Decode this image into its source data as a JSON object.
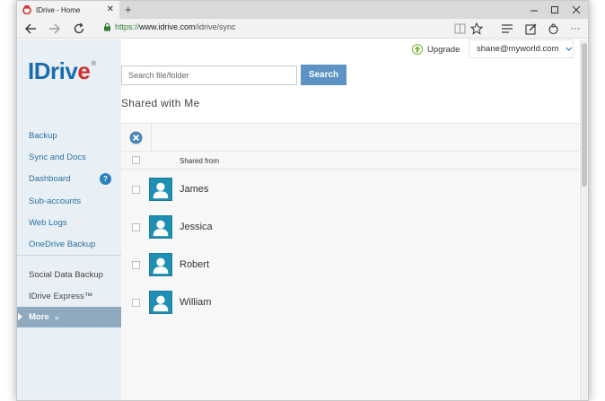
{
  "browser": {
    "tab_title": "IDrive - Home",
    "tab_close": "✕",
    "new_tab": "+",
    "url_scheme": "https://",
    "url_host": "www.idrive.com",
    "url_path": "/idrive/sync",
    "more_menu": "···"
  },
  "header": {
    "logo_text": "IDriv",
    "logo_e": "e",
    "logo_reg": "®",
    "upgrade_label": "Upgrade",
    "user_email": "shane@myworld.com"
  },
  "search": {
    "placeholder": "Search file/folder",
    "button_label": "Search"
  },
  "page_title": "Shared with Me",
  "sidebar": {
    "items": [
      {
        "label": "Backup"
      },
      {
        "label": "Sync and Docs"
      },
      {
        "label": "Dashboard"
      },
      {
        "label": "Sub-accounts"
      },
      {
        "label": "Web Logs"
      },
      {
        "label": "OneDrive Backup"
      },
      {
        "label": "Social Data Backup"
      },
      {
        "label": "IDrive Express™"
      }
    ],
    "help_badge": "?",
    "more_label": "More",
    "more_chevrons": "»"
  },
  "table": {
    "column_header": "Shared from",
    "rows": [
      {
        "name": "James"
      },
      {
        "name": "Jessica"
      },
      {
        "name": "Robert"
      },
      {
        "name": "William"
      }
    ]
  },
  "colors": {
    "accent": "#5c93c4",
    "avatar": "#1f8fb3",
    "sidebar_bg": "#e9f0f5",
    "more_bg": "#8fa9bf"
  }
}
